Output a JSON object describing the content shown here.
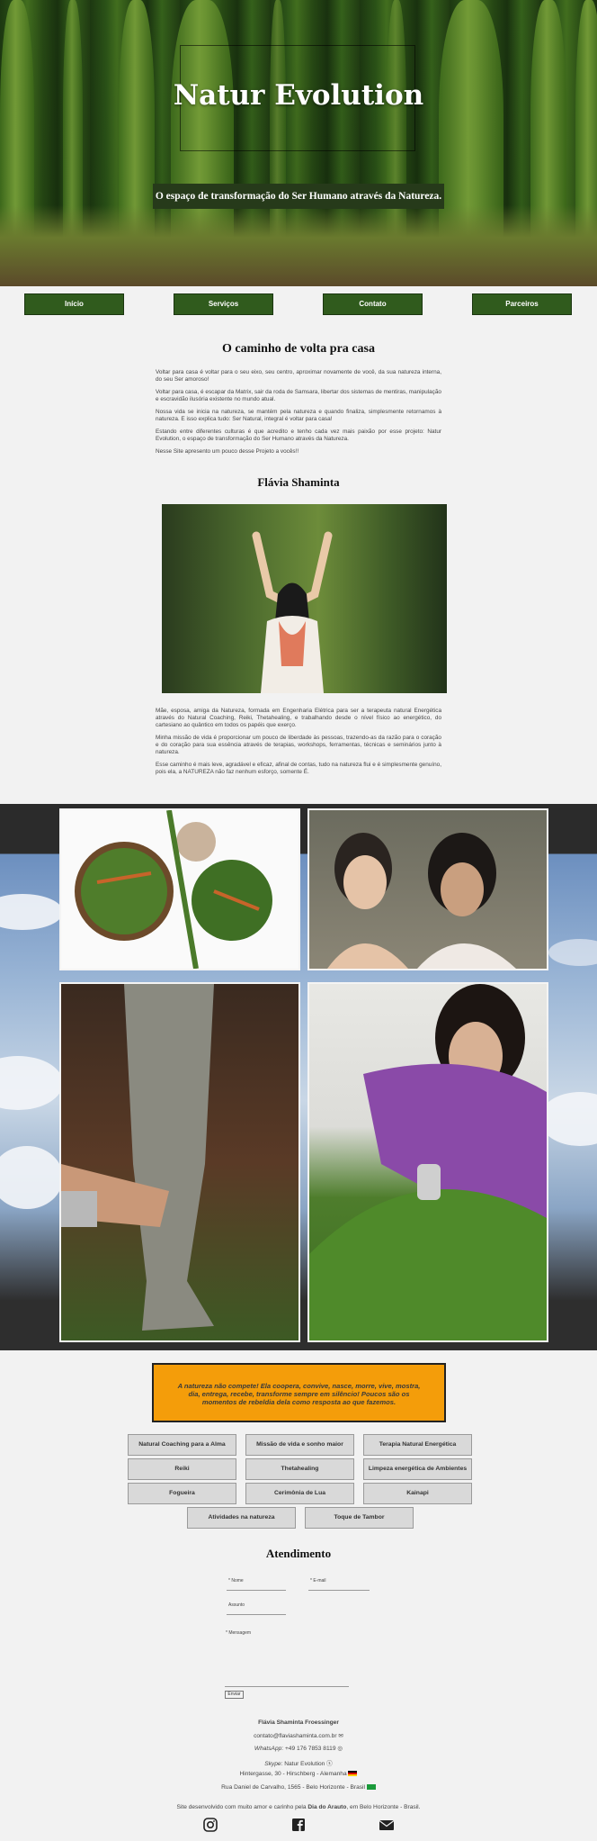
{
  "hero": {
    "title": "Natur Evolution",
    "subtitle": "O espaço de transformação do Ser Humano através da Natureza."
  },
  "nav": [
    "Início",
    "Serviços",
    "Contato",
    "Parceiros"
  ],
  "intro": {
    "title": "O caminho de volta pra casa",
    "paragraphs": [
      "Voltar para casa é voltar para o seu eixo, seu centro, aproximar novamente de você, da sua natureza interna, do seu Ser amoroso!",
      "Voltar para casa, é escapar da Matrix, sair da roda de Samsara, libertar dos sistemas de mentiras, manipulação e escravidão ilusória existente no mundo atual.",
      "Nossa vida se inicia na natureza, se mantém pela natureza e quando finaliza, simplesmente retornamos à natureza. E isso explica tudo: Ser Natural, integral é voltar para casa!",
      "Estando entre diferentes culturas é que acredito e tenho cada vez mais paixão por esse projeto: Natur Evolution, o espaço de transformação do Ser Humano através da Natureza.",
      "Nesse Site apresento um pouco desse Projeto a vocês!!"
    ]
  },
  "bio": {
    "title": "Flávia Shaminta",
    "paragraphs": [
      "Mãe, esposa, amiga da Natureza, formada em Engenharia Elétrica para ser a terapeuta natural Energética através do Natural Coaching, Reiki, Thetahealing, e trabalhando desde o nível físico ao energético, do cartesiano ao quântico em todos os papéis que exerço.",
      "Minha missão de vida é proporcionar um pouco de liberdade às pessoas, trazendo-as da razão para o coração e do coração para sua essência através de terapias, workshops, ferramentas, técnicas e seminários junto à natureza.",
      "Esse caminho é mais leve, agradável e eficaz, afinal de contas, tudo na natureza flui e é simplesmente genuíno, pois ela, a NATUREZA não faz nenhum esforço, somente É."
    ]
  },
  "quote": "A natureza não compete! Ela coopera, convive, nasce, morre, vive, mostra, dia, entrega, recebe, transforme sempre em silêncio! Poucos são os momentos de rebeldia dela como resposta ao que fazemos.",
  "services": [
    "Natural Coaching para a Alma",
    "Missão de vida e sonho maior",
    "Terapia Natural Energética",
    "Reiki",
    "Thetahealing",
    "Limpeza energética de Ambientes",
    "Fogueira",
    "Cerimônia de Lua",
    "Kainapi",
    "Atividades na natureza",
    "Toque de Tambor"
  ],
  "contact": {
    "title": "Atendimento",
    "name_label": "* Nome",
    "email_label": "* E-mail",
    "subject_label": "Assunto",
    "message_label": "* Mensagem",
    "submit": "Enviar"
  },
  "footer": {
    "name": "Flávia Shaminta Froessinger",
    "email": "contato@flaviashaminta.com.br",
    "whatsapp_label": "WhatsApp",
    "whatsapp": ": +49 176 7853 8119",
    "skype_label": "Skype",
    "skype": ": Natur Evolution",
    "address_de": "Hintergasse, 30 - Hirschberg - Alemanha",
    "address_br": "Rua Daniel de Carvalho, 1565 - Belo Horizonte - Brasil",
    "credit_prefix": "Site desenvolvido com muito amor e carinho pela ",
    "credit_name": "Dia do Arauto",
    "credit_suffix": ", em Belo Horizonte - Brasil.",
    "icons": [
      "instagram-icon",
      "facebook-icon",
      "email-icon"
    ]
  },
  "colors": {
    "nav": "#305b1d",
    "quote_bg": "#f49d0a",
    "page_bg": "#f2f2f2"
  }
}
